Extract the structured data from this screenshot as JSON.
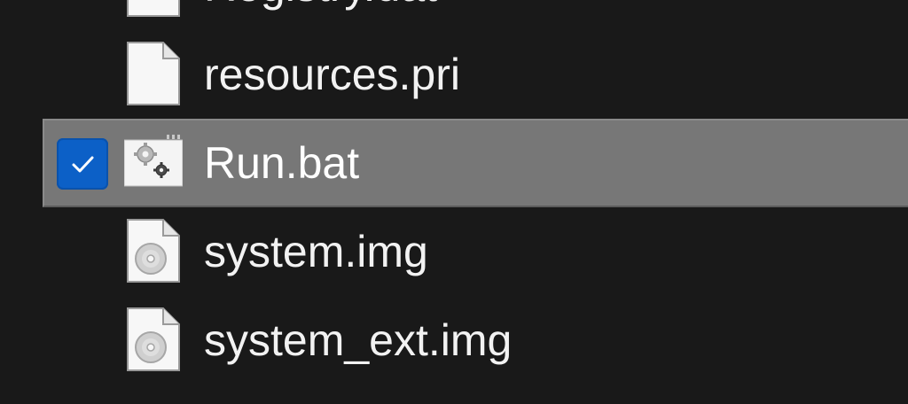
{
  "files": [
    {
      "name": "Registry.dat",
      "icon": "generic-file-icon",
      "selected": false,
      "checked": false
    },
    {
      "name": "resources.pri",
      "icon": "generic-file-icon",
      "selected": false,
      "checked": false
    },
    {
      "name": "Run.bat",
      "icon": "batch-file-icon",
      "selected": true,
      "checked": true
    },
    {
      "name": "system.img",
      "icon": "disc-image-file-icon",
      "selected": false,
      "checked": false
    },
    {
      "name": "system_ext.img",
      "icon": "disc-image-file-icon",
      "selected": false,
      "checked": false
    }
  ],
  "colors": {
    "background": "#191919",
    "selection": "#777777",
    "checkbox": "#0c60c7",
    "text": "#f2f2f2"
  }
}
